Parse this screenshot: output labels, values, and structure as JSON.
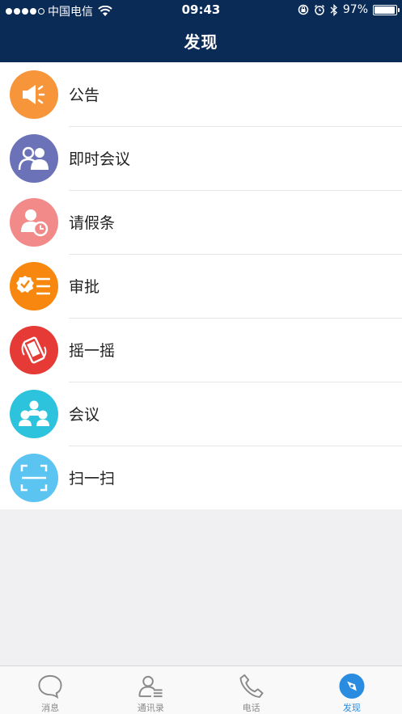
{
  "status_bar": {
    "carrier": "中国电信",
    "time": "09:43",
    "battery": "97%",
    "battery_level": 0.97,
    "signal_dots": 4
  },
  "header": {
    "title": "发现"
  },
  "items": [
    {
      "label": "公告",
      "icon": "megaphone-icon",
      "color": "#f7953b"
    },
    {
      "label": "即时会议",
      "icon": "instant-meeting-icon",
      "color": "#6b72b8"
    },
    {
      "label": "请假条",
      "icon": "leave-request-icon",
      "color": "#f38a8a"
    },
    {
      "label": "审批",
      "icon": "approval-icon",
      "color": "#f7870e"
    },
    {
      "label": "摇一摇",
      "icon": "shake-phone-icon",
      "color": "#e53a36"
    },
    {
      "label": "会议",
      "icon": "meeting-icon",
      "color": "#2ec3dd"
    },
    {
      "label": "扫一扫",
      "icon": "scan-icon",
      "color": "#5bc4f0"
    }
  ],
  "tabs": [
    {
      "label": "消息",
      "icon": "chat-bubble-icon",
      "active": false
    },
    {
      "label": "通讯录",
      "icon": "contacts-icon",
      "active": false
    },
    {
      "label": "电话",
      "icon": "phone-icon",
      "active": false
    },
    {
      "label": "发现",
      "icon": "compass-icon",
      "active": true
    }
  ],
  "colors": {
    "header_bg": "#0b2b57",
    "active_tab": "#2a8ce0",
    "inactive_tab": "#8a8a8a"
  }
}
